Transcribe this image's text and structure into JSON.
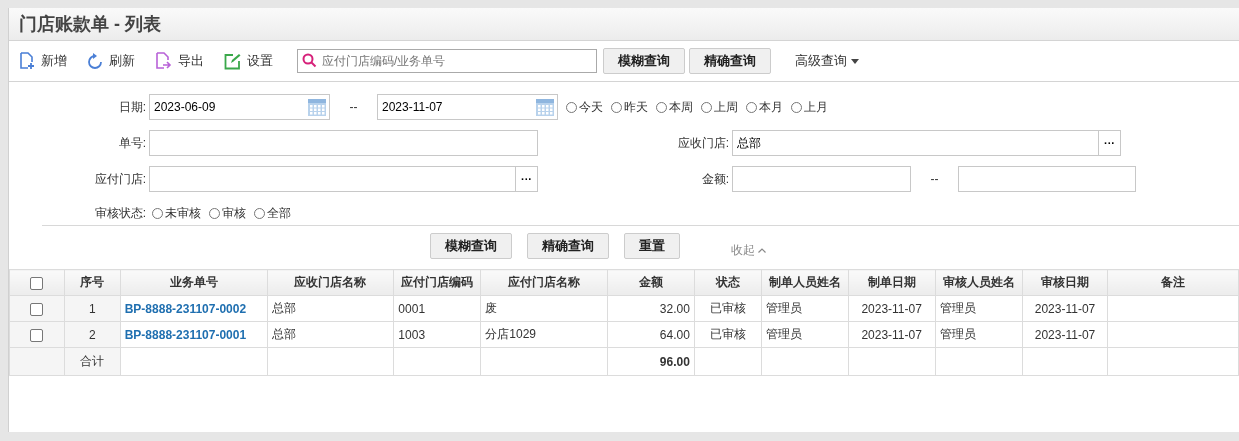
{
  "window": {
    "title": "门店账款单 - 列表"
  },
  "toolbar": {
    "buttons": [
      {
        "kind": "add",
        "label": "新增"
      },
      {
        "kind": "refresh",
        "label": "刷新"
      },
      {
        "kind": "export",
        "label": "导出"
      },
      {
        "kind": "settings",
        "label": "设置"
      }
    ],
    "search": {
      "placeholder": "应付门店编码/业务单号"
    },
    "search_buttons": [
      "模糊查询",
      "精确查询"
    ],
    "advanced": "高级查询"
  },
  "filters": {
    "date": {
      "label": "日期:",
      "from": "2023-06-09",
      "separator": "--",
      "to": "2023-11-07",
      "quick": [
        {
          "label": "今天",
          "selected": false
        },
        {
          "label": "昨天",
          "selected": false
        },
        {
          "label": "本周",
          "selected": false
        },
        {
          "label": "上周",
          "selected": false
        },
        {
          "label": "本月",
          "selected": false
        },
        {
          "label": "上月",
          "selected": false
        }
      ]
    },
    "order_no": {
      "label": "单号:"
    },
    "receiving_store": {
      "label": "应收门店:",
      "value": "总部",
      "picker": "···"
    },
    "paying_store": {
      "label": "应付门店:",
      "picker": "···"
    },
    "amount": {
      "label": "金额:",
      "separator": "--"
    },
    "audit_status": {
      "label": "审核状态:",
      "options": [
        {
          "label": "未审核",
          "selected": false
        },
        {
          "label": "审核",
          "selected": false
        },
        {
          "label": "全部",
          "selected": false
        }
      ]
    },
    "buttons": [
      "模糊查询",
      "精确查询",
      "重置"
    ],
    "collapse": "收起"
  },
  "table": {
    "select_all": {
      "checked": false
    },
    "columns": [
      "序号",
      "业务单号",
      "应收门店名称",
      "应付门店编码",
      "应付门店名称",
      "金额",
      "状态",
      "制单人员姓名",
      "制单日期",
      "审核人员姓名",
      "审核日期",
      "备注"
    ],
    "rows": [
      {
        "checked": false,
        "cells": [
          "1",
          "BP-8888-231107-0002",
          "总部",
          "0001",
          "废",
          "32.00",
          "已审核",
          "管理员",
          "2023-11-07",
          "管理员",
          "2023-11-07",
          ""
        ]
      },
      {
        "checked": false,
        "cells": [
          "2",
          "BP-8888-231107-0001",
          "总部",
          "1003",
          "分店1029",
          "64.00",
          "已审核",
          "管理员",
          "2023-11-07",
          "管理员",
          "2023-11-07",
          ""
        ]
      }
    ],
    "total": {
      "label": "合计",
      "amount": "96.00"
    }
  }
}
